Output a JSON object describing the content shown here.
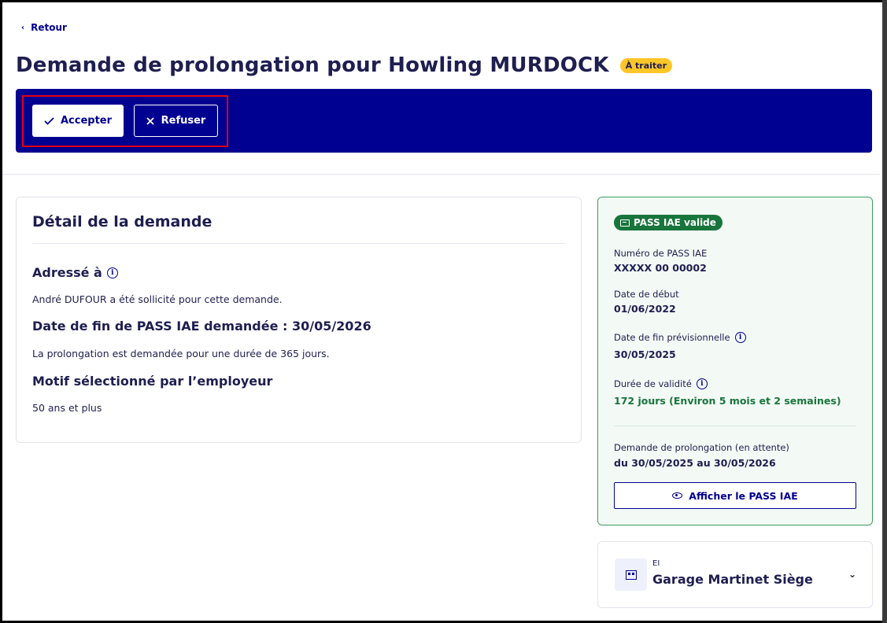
{
  "nav": {
    "back_label": "Retour"
  },
  "header": {
    "title": "Demande de prolongation pour Howling MURDOCK",
    "status_badge": "À traiter"
  },
  "actions": {
    "accept_label": "Accepter",
    "refuse_label": "Refuser"
  },
  "detail": {
    "title": "Détail de la demande",
    "addressed_heading": "Adressé à",
    "addressed_text": "André DUFOUR a été sollicité pour cette demande.",
    "end_date_heading": "Date de fin de PASS IAE demandée : 30/05/2026",
    "duration_text": "La prolongation est demandée pour une durée de 365 jours.",
    "reason_heading": "Motif sélectionné par l’employeur",
    "reason_text": "50 ans et plus"
  },
  "pass": {
    "badge": "PASS IAE valide",
    "number_label": "Numéro de PASS IAE",
    "number_value": "XXXXX 00 00002",
    "start_label": "Date de début",
    "start_value": "01/06/2022",
    "end_label": "Date de fin prévisionnelle",
    "end_value": "30/05/2025",
    "validity_label": "Durée de validité",
    "validity_value": "172 jours (Environ 5 mois et 2 semaines)",
    "extension_label": "Demande de prolongation (en attente)",
    "extension_value": "du 30/05/2025 au 30/05/2026",
    "show_button": "Afficher le PASS IAE"
  },
  "company": {
    "type": "EI",
    "name": "Garage Martinet Siège"
  },
  "colors": {
    "primary": "#000091",
    "badge_yellow": "#ffc627",
    "success_green": "#18753c",
    "highlight_red": "#e1000f"
  }
}
